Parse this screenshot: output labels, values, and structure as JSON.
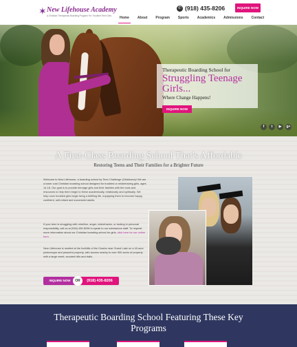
{
  "header": {
    "logo_title": "New Lifehouse Academy",
    "logo_subtitle": "A Christian Therapeutic Boarding Program For Troubled Teen Girls",
    "phone": "(918) 435-8206",
    "inquire_label": "INQUIRE NOW",
    "nav": [
      "Home",
      "About",
      "Program",
      "Sports",
      "Academics",
      "Admissions",
      "Contact"
    ],
    "active_nav": "Home",
    "accent_color": "#e0147d",
    "brand_color": "#8a2d8f"
  },
  "hero": {
    "line1": "Therapeutic Boarding School for",
    "line2a": "Struggling Teenage",
    "line2b": "Girls...",
    "line3": "Where Change Happens!",
    "button_label": "INQUIRE NOW",
    "social_icons": [
      "facebook-icon",
      "twitter-icon",
      "youtube-icon",
      "googleplus-icon"
    ],
    "social_glyphs": [
      "f",
      "t",
      "▶",
      "g+"
    ]
  },
  "intro": {
    "title": "A First-Class Boarding School That's Affordable",
    "subtitle": "Restoring Teens and Their Families for a Brighter Future",
    "paragraph1": "Welcome to New Lifehouse, a boarding school by Teen Challenge (Oklahoma)! We are a lower cost Christian boarding school designed for troubled or misbehaving girls, ages 14-18. Our goal is to provide teenage girls and their families with the tools and resources to help them begin to thrive academically, relationally and spiritually. We help once troubled girls begin living a fulfilling life, equipping them to become happy, confident, self-reliant and successful adults.",
    "paragraph2_before": "If your teen is struggling with rebellion, anger, misbehavior, or lacking in personal responsibility, call us at (918) 435-8206 to speak to our admissions staff. To request more information about our Christian boarding school for girls,",
    "paragraph2_link": "click here for our online form.",
    "paragraph3": "New Lifehouse is nestled at the foothills of the Ozarks near Grand Lake on a 40-acre picturesque and peaceful property, with access nearby to over 900 acres of property with a large creek, wooded hills and trails.",
    "inquire_label": "INQUIRE NOW",
    "or_label": "OR",
    "phone": "(918) 435-8206"
  },
  "programs": {
    "title_line1": "Therapeutic Boarding School Featuring These Key",
    "title_line2": "Programs"
  }
}
